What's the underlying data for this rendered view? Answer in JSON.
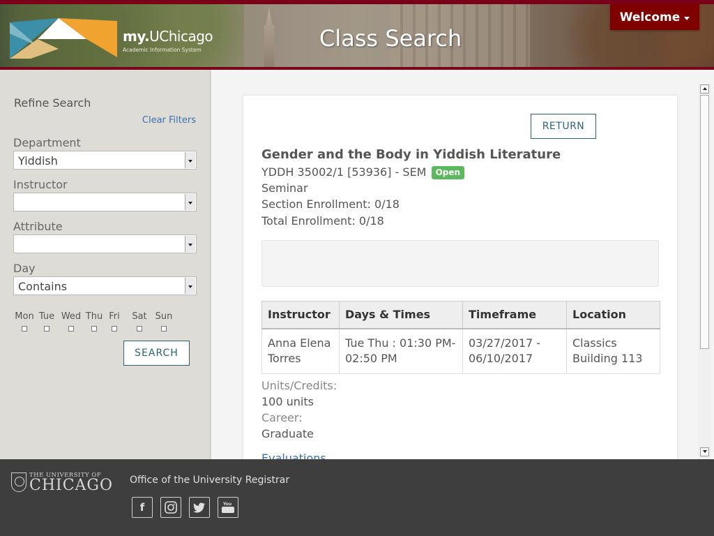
{
  "header": {
    "logo_main_bold": "my.",
    "logo_main": "UChicago",
    "logo_sub": "Academic Information System",
    "title": "Class Search",
    "welcome_label": "Welcome"
  },
  "sidebar": {
    "heading": "Refine Search",
    "clear_filters": "Clear Filters",
    "department": {
      "label": "Department",
      "value": "Yiddish"
    },
    "instructor": {
      "label": "Instructor",
      "value": ""
    },
    "attribute": {
      "label": "Attribute",
      "value": ""
    },
    "day": {
      "label": "Day",
      "value": "Contains"
    },
    "days": [
      "Mon",
      "Tue",
      "Wed",
      "Thu",
      "Fri",
      "Sat",
      "Sun"
    ],
    "search_label": "SEARCH"
  },
  "course": {
    "return_label": "RETURN",
    "title": "Gender and the Body in Yiddish Literature",
    "code": "YDDH 35002/1 [53936] - SEM",
    "status": "Open",
    "type": "Seminar",
    "section_enrollment": "Section Enrollment: 0/18",
    "total_enrollment": "Total Enrollment: 0/18",
    "schedule": {
      "headers": [
        "Instructor",
        "Days & Times",
        "Timeframe",
        "Location"
      ],
      "row": [
        "Anna Elena Torres",
        "Tue Thu : 01:30 PM-02:50 PM",
        "03/27/2017 - 06/10/2017",
        "Classics Building 113"
      ]
    },
    "units_label": "Units/Credits:",
    "units_value": "100 units",
    "career_label": "Career:",
    "career_value": "Graduate",
    "evaluations": "Evaluations"
  },
  "footer": {
    "uc_small": "THE UNIVERSITY OF",
    "uc_big": "CHICAGO",
    "office": "Office of the University Registrar",
    "social_icons": [
      "facebook-icon",
      "instagram-icon",
      "twitter-icon",
      "youtube-icon"
    ]
  },
  "colors": {
    "maroon": "#800000",
    "button_text": "#2b6478",
    "link": "#3a6fb0",
    "open_badge": "#5cb85c",
    "footer_bg": "#3e3e3e"
  }
}
